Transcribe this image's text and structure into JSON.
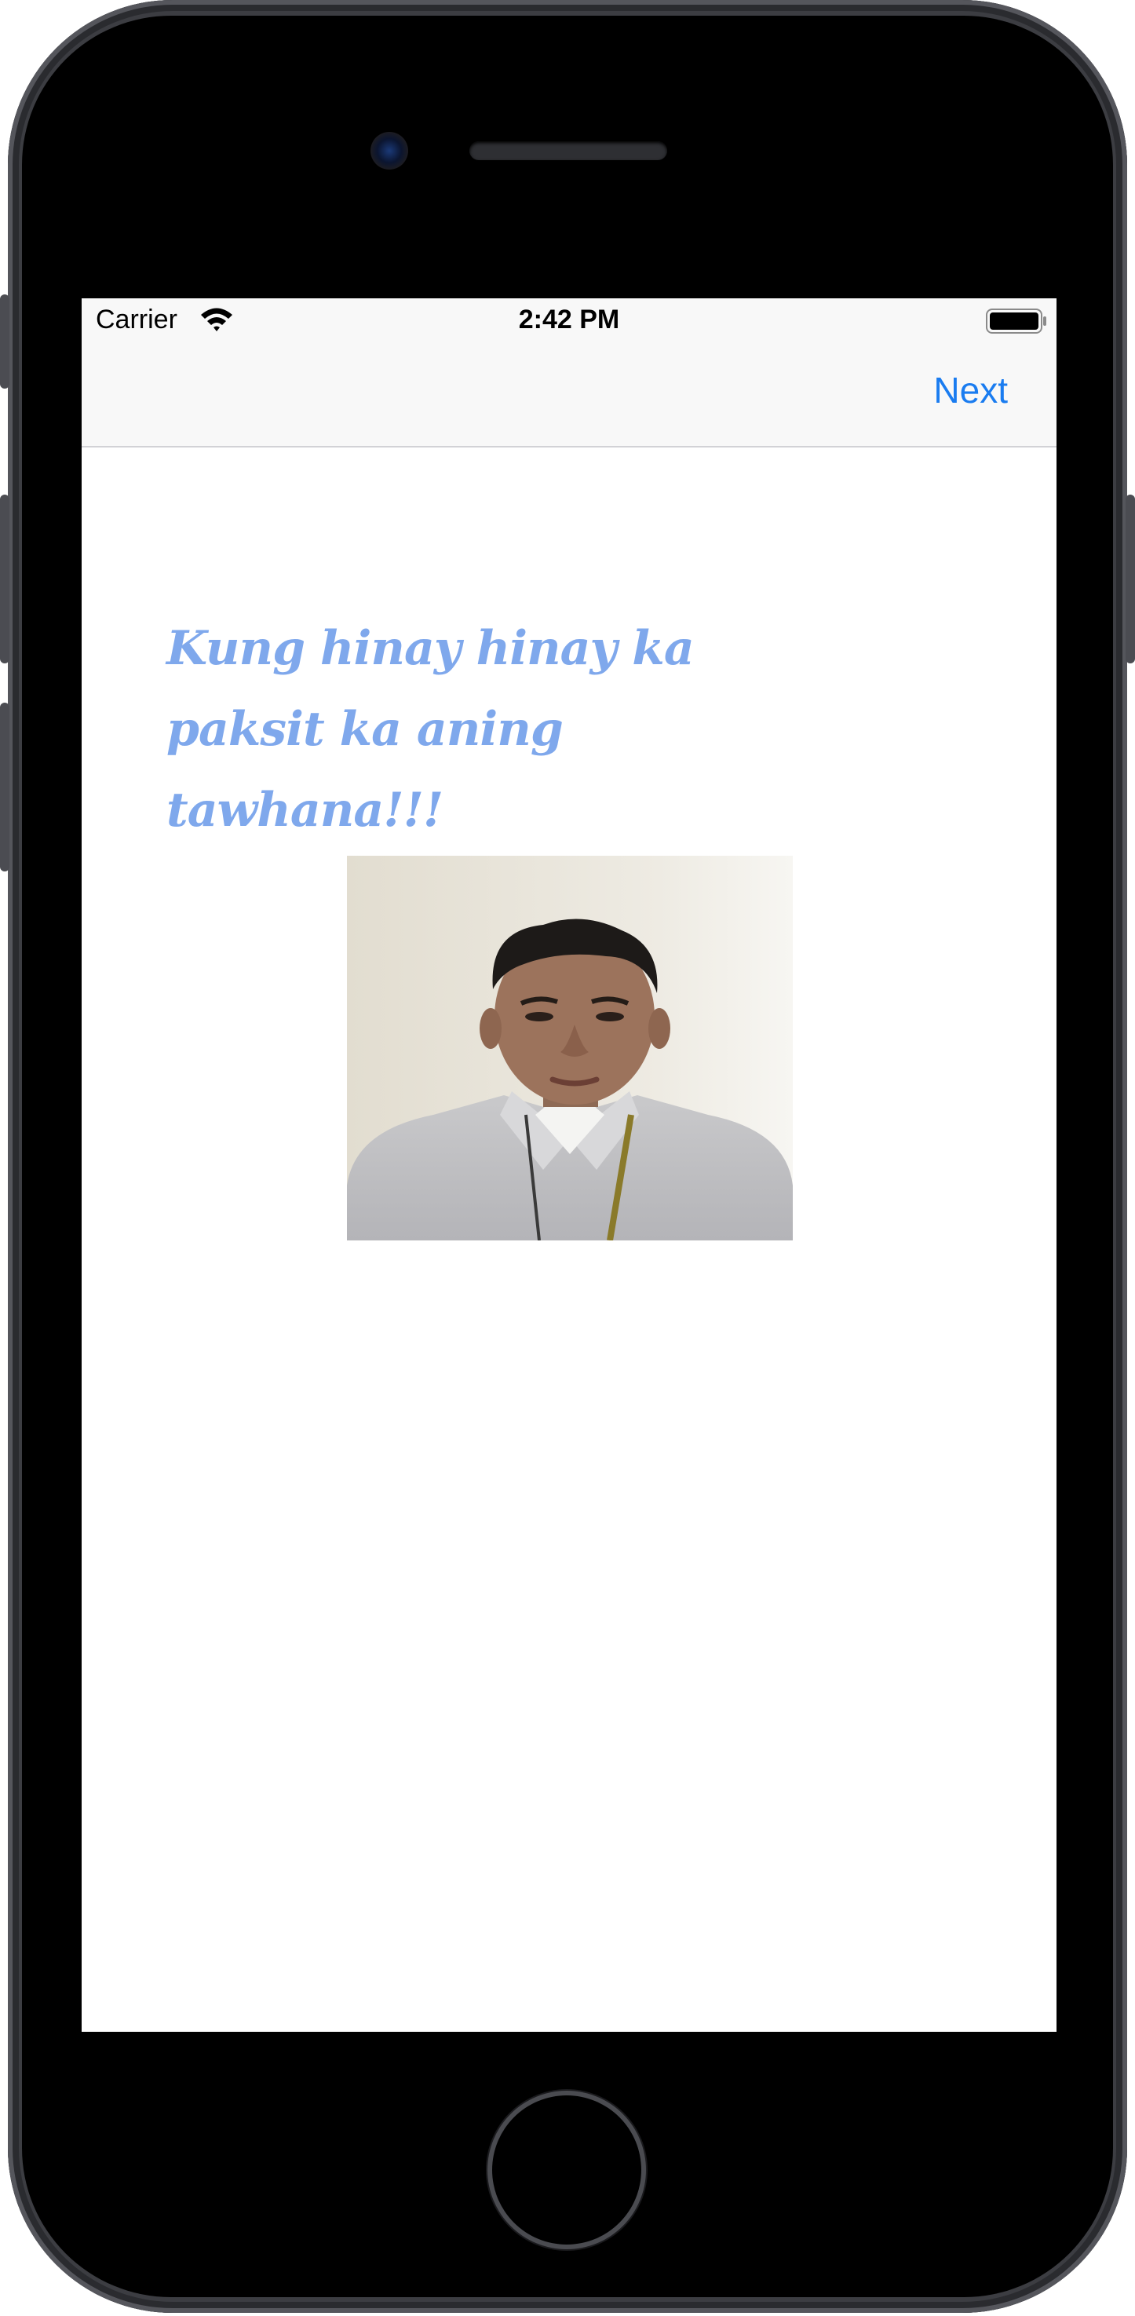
{
  "status_bar": {
    "carrier": "Carrier",
    "time": "2:42 PM",
    "wifi_icon": "wifi-icon",
    "battery_icon": "battery-icon"
  },
  "nav_bar": {
    "right_button_label": "Next"
  },
  "content": {
    "quote": "Kung hinay hinay ka paksit ka aning tawhana!!!",
    "photo_icon": "person-portrait-image"
  },
  "colors": {
    "accent": "#1a7cf0",
    "quote_text": "#7fa8ec",
    "bar_background": "#f8f8f8"
  }
}
